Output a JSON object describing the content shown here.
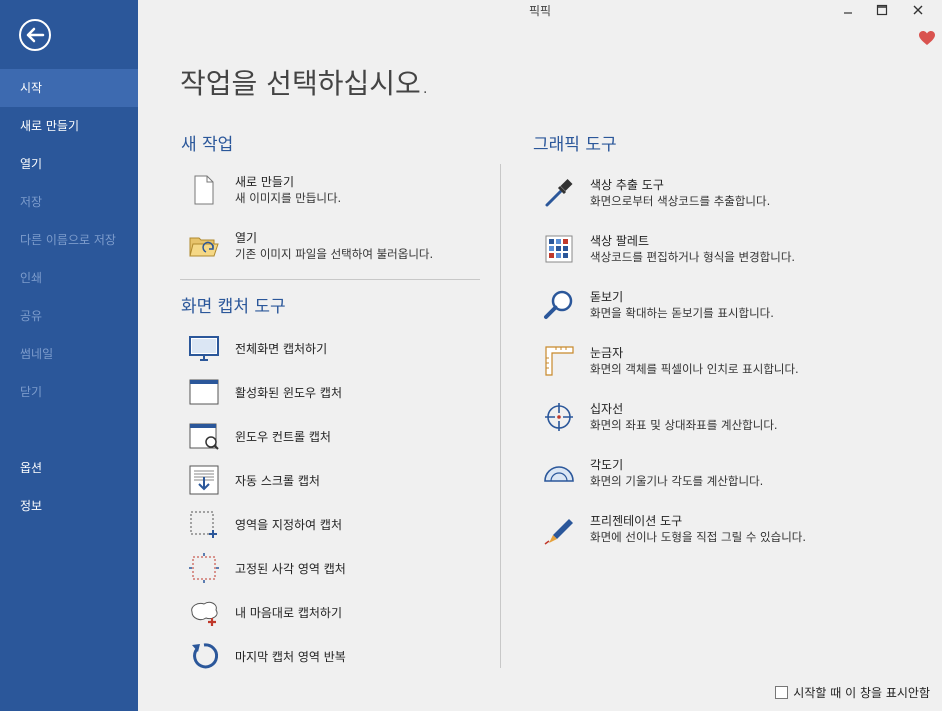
{
  "window": {
    "title": "픽픽"
  },
  "sidebar": {
    "items": [
      {
        "label": "시작",
        "state": "active"
      },
      {
        "label": "새로 만들기",
        "state": "normal"
      },
      {
        "label": "열기",
        "state": "normal"
      },
      {
        "label": "저장",
        "state": "disabled"
      },
      {
        "label": "다른 이름으로 저장",
        "state": "disabled"
      },
      {
        "label": "인쇄",
        "state": "disabled"
      },
      {
        "label": "공유",
        "state": "disabled"
      },
      {
        "label": "썸네일",
        "state": "disabled"
      },
      {
        "label": "닫기",
        "state": "disabled"
      },
      {
        "label": "옵션",
        "state": "normal"
      },
      {
        "label": "정보",
        "state": "normal"
      }
    ]
  },
  "main": {
    "title": "작업을 선택하십시오.",
    "new_task": {
      "title": "새 작업",
      "items": [
        {
          "label": "새로 만들기",
          "desc": "새 이미지를 만듭니다.",
          "icon": "new-file-icon"
        },
        {
          "label": "열기",
          "desc": "기존 이미지 파일을 선택하여 불러옵니다.",
          "icon": "open-folder-icon"
        }
      ]
    },
    "capture": {
      "title": "화면 캡처 도구",
      "items": [
        {
          "label": "전체화면 캡처하기",
          "icon": "monitor-icon"
        },
        {
          "label": "활성화된 윈도우 캡처",
          "icon": "active-window-icon"
        },
        {
          "label": "윈도우 컨트롤 캡처",
          "icon": "window-control-icon"
        },
        {
          "label": "자동 스크롤 캡처",
          "icon": "scroll-capture-icon"
        },
        {
          "label": "영역을 지정하여 캡처",
          "icon": "region-icon"
        },
        {
          "label": "고정된 사각 영역 캡처",
          "icon": "fixed-region-icon"
        },
        {
          "label": "내 마음대로 캡처하기",
          "icon": "freehand-icon"
        },
        {
          "label": "마지막 캡처 영역 반복",
          "icon": "repeat-icon"
        }
      ]
    },
    "graphics": {
      "title": "그래픽 도구",
      "items": [
        {
          "label": "색상 추출 도구",
          "desc": "화면으로부터 색상코드를 추출합니다.",
          "icon": "eyedropper-icon"
        },
        {
          "label": "색상 팔레트",
          "desc": "색상코드를 편집하거나 형식을 변경합니다.",
          "icon": "palette-icon"
        },
        {
          "label": "돋보기",
          "desc": "화면을 확대하는 돋보기를 표시합니다.",
          "icon": "magnifier-icon"
        },
        {
          "label": "눈금자",
          "desc": "화면의 객체를 픽셀이나 인치로 표시합니다.",
          "icon": "ruler-icon"
        },
        {
          "label": "십자선",
          "desc": "화면의 좌표 및 상대좌표를 계산합니다.",
          "icon": "crosshair-icon"
        },
        {
          "label": "각도기",
          "desc": "화면의 기울기나 각도를 계산합니다.",
          "icon": "protractor-icon"
        },
        {
          "label": "프리젠테이션 도구",
          "desc": "화면에 선이나 도형을 직접 그릴 수 있습니다.",
          "icon": "pen-icon"
        }
      ]
    }
  },
  "footer": {
    "checkbox_label": "시작할 때 이 창을 표시안함",
    "checked": false
  },
  "colors": {
    "sidebar": "#2b579a",
    "accent": "#2b579a",
    "heart": "#d9534f"
  }
}
